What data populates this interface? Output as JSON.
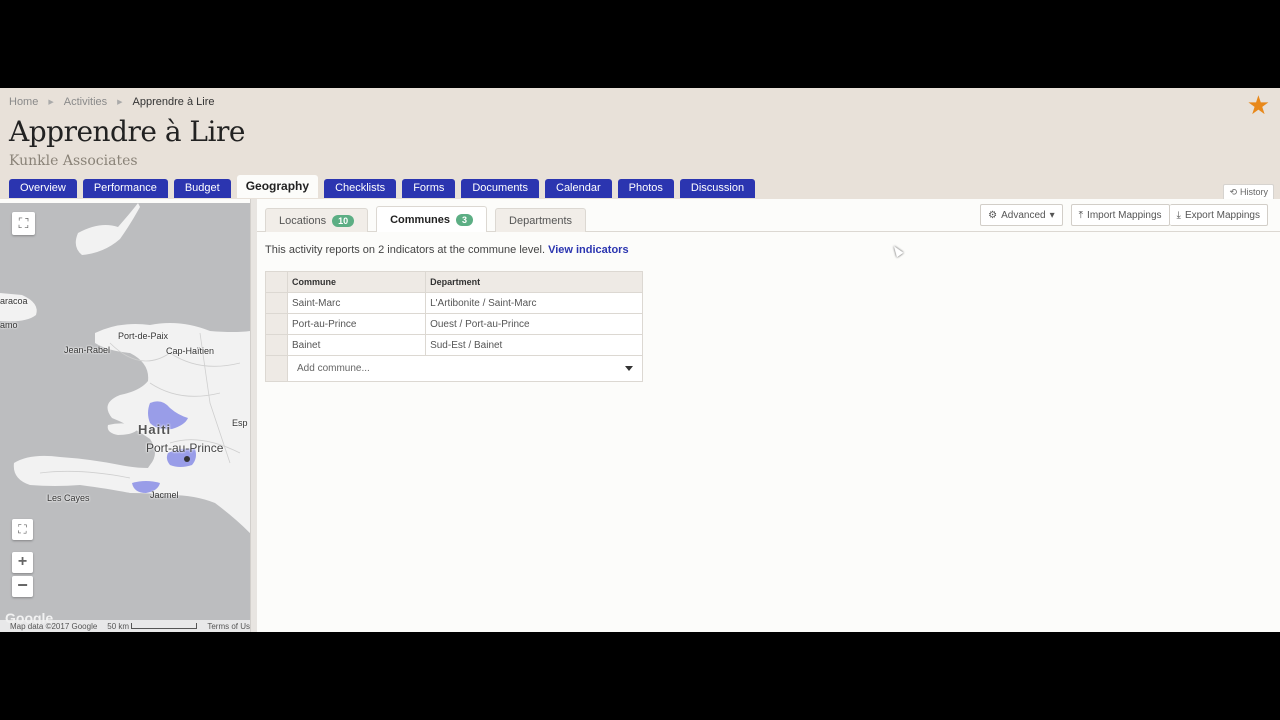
{
  "breadcrumb": [
    "Home",
    "Activities",
    "Apprendre à Lire"
  ],
  "title": "Apprendre à Lire",
  "subtitle": "Kunkle Associates",
  "favorite_icon": "star-icon",
  "tabs": [
    {
      "label": "Overview"
    },
    {
      "label": "Performance"
    },
    {
      "label": "Budget"
    },
    {
      "label": "Geography",
      "active": true
    },
    {
      "label": "Checklists"
    },
    {
      "label": "Forms"
    },
    {
      "label": "Documents"
    },
    {
      "label": "Calendar"
    },
    {
      "label": "Photos"
    },
    {
      "label": "Discussion"
    }
  ],
  "history_label": "History",
  "subtabs": [
    {
      "label": "Locations",
      "count": "10"
    },
    {
      "label": "Communes",
      "count": "3",
      "active": true
    },
    {
      "label": "Departments"
    }
  ],
  "toolbar": {
    "advanced": "Advanced",
    "import": "Import Mappings",
    "export": "Export Mappings"
  },
  "info": {
    "text": "This activity reports on 2 indicators at the commune level.",
    "link": "View indicators"
  },
  "table": {
    "headers": [
      "Commune",
      "Department"
    ],
    "rows": [
      [
        "Saint-Marc",
        "L'Artibonite / Saint-Marc"
      ],
      [
        "Port-au-Prince",
        "Ouest / Port-au-Prince"
      ],
      [
        "Bainet",
        "Sud-Est / Bainet"
      ]
    ],
    "add_placeholder": "Add commune..."
  },
  "map": {
    "labels": [
      "aracoa",
      "amo",
      "Port-de-Paix",
      "Jean-Rabel",
      "Cap-Haïtien",
      "Haiti",
      "Port-au-Prince",
      "Les Cayes",
      "Jacmel",
      "Esp"
    ],
    "footer": {
      "attribution": "Map data ©2017 Google",
      "scale": "50 km",
      "terms": "Terms of Use"
    },
    "logo": "Google"
  },
  "colors": {
    "accent": "#2b35b0",
    "header_bg": "#e8e1d9",
    "badge": "#5cae84",
    "star": "#e8881a",
    "region": "#8a8ee6"
  }
}
